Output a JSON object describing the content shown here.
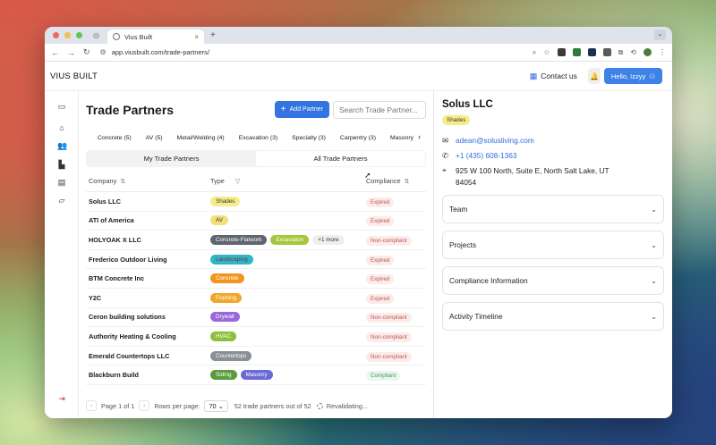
{
  "browser": {
    "tab_title": "Vius Built",
    "tab_close": "×",
    "new_tab": "+",
    "url": "app.viusbuilt.com/trade-partners/"
  },
  "header": {
    "brand": "VIUS BUILT",
    "contact_label": "Contact us",
    "user_button": "Hello, Izzyy"
  },
  "main": {
    "title": "Trade Partners",
    "add_button": "Add Partner",
    "search_placeholder": "Search Trade Partner...",
    "filters": [
      "Concrete (5)",
      "AV (5)",
      "Metal/Welding (4)",
      "Excavation (3)",
      "Specialty (3)",
      "Carpentry (3)",
      "Masonry"
    ],
    "tabs": [
      "My Trade Partners",
      "All Trade Partners"
    ],
    "columns": {
      "company": "Company",
      "type": "Type",
      "compliance": "Compliance"
    },
    "rows": [
      {
        "company": "Solus LLC",
        "tags": [
          {
            "label": "Shades",
            "color": "#f7ec8a"
          }
        ],
        "status": "Expired"
      },
      {
        "company": "ATI of America",
        "tags": [
          {
            "label": "AV",
            "color": "#f3e07a"
          }
        ],
        "status": "Expired"
      },
      {
        "company": "HOLYOAK X LLC",
        "tags": [
          {
            "label": "Concrete-Flatwork",
            "color": "#5f6670"
          },
          {
            "label": "Excavation",
            "color": "#a8c63a"
          },
          {
            "label": "+1 more",
            "color": "#efefef"
          }
        ],
        "status": "Non-compliant"
      },
      {
        "company": "Frederico Outdoor Living",
        "tags": [
          {
            "label": "Landscaping",
            "color": "#2bb7c9"
          }
        ],
        "status": "Expired"
      },
      {
        "company": "BTM Concrete Inc",
        "tags": [
          {
            "label": "Concrete",
            "color": "#f0961e"
          }
        ],
        "status": "Expired"
      },
      {
        "company": "Y2C",
        "tags": [
          {
            "label": "Framing",
            "color": "#f2a72c"
          }
        ],
        "status": "Expired"
      },
      {
        "company": "Ceron building solutions",
        "tags": [
          {
            "label": "Drywall",
            "color": "#9a68d8"
          }
        ],
        "status": "Non-compliant"
      },
      {
        "company": "Authority Heating & Cooling",
        "tags": [
          {
            "label": "HVAC",
            "color": "#8fbe3c"
          }
        ],
        "status": "Non-compliant"
      },
      {
        "company": "Emerald Countertops LLC",
        "tags": [
          {
            "label": "Countertops",
            "color": "#8a8f96"
          }
        ],
        "status": "Non-compliant"
      },
      {
        "company": "Blackburn Build",
        "tags": [
          {
            "label": "Siding",
            "color": "#5b9b3a"
          },
          {
            "label": "Masonry",
            "color": "#6a6ad6"
          }
        ],
        "status": "Compliant"
      }
    ],
    "pager": {
      "prev": "‹",
      "page_text": "Page 1 of 1",
      "next": "›",
      "rows_label": "Rows per page:",
      "rows_value": "70",
      "total_text": "52 trade partners out of 52",
      "revalidating": "Revalidating..."
    }
  },
  "detail": {
    "name": "Solus LLC",
    "badge": "Shades",
    "badge_color": "#f7ec8a",
    "email": "adean@solusliving.com",
    "phone": "+1 (435) 608-1363",
    "address_line1": "925 W 100 North, Suite E, North Salt Lake, UT",
    "address_line2": "84054",
    "sections": [
      "Team",
      "Projects",
      "Compliance Information",
      "Activity Timeline"
    ]
  },
  "colors": {
    "primary": "#3474e0",
    "link": "#2f6de1",
    "expired_bg": "#fbeceb",
    "expired_fg": "#c15450",
    "compliant_fg": "#3a9b62"
  },
  "icons": {
    "sidebar": [
      "panel-icon",
      "home-icon",
      "users-icon",
      "chart-icon",
      "clipboard-icon",
      "folder-icon",
      "logout-icon"
    ]
  }
}
